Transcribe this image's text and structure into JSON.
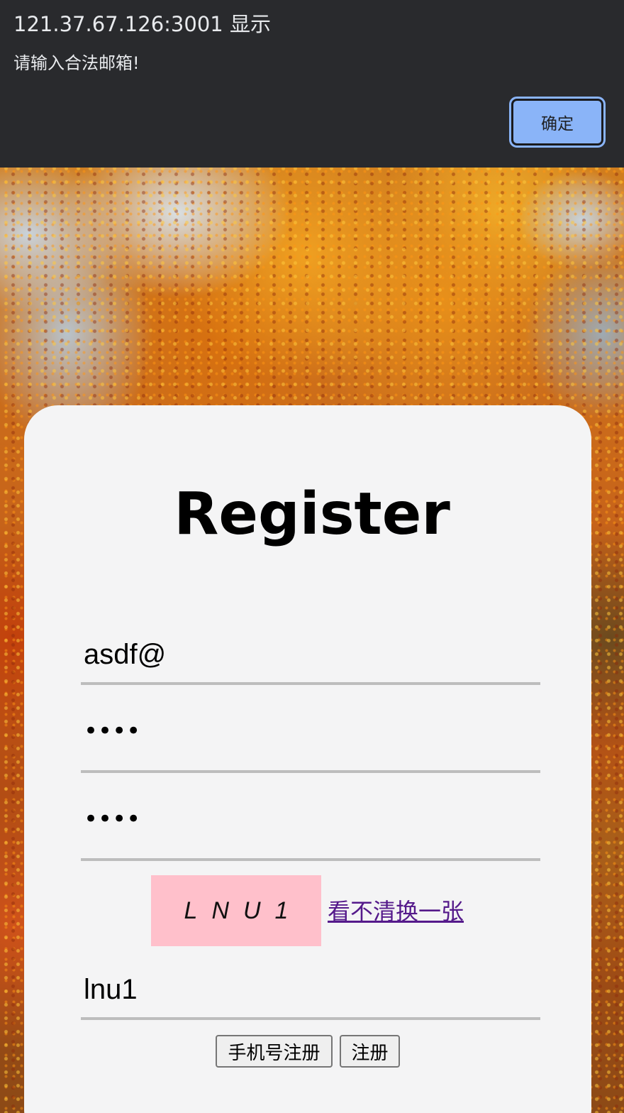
{
  "alert": {
    "title": "121.37.67.126:3001 显示",
    "message": "请输入合法邮箱!",
    "ok_label": "确定",
    "background": "#292a2d",
    "button_color": "#8ab4f8"
  },
  "register": {
    "title": "Register",
    "email_value": "asdf@",
    "password_masked": "••••",
    "confirm_password_masked": "••••",
    "captcha_text": "LNU1",
    "captcha_background": "#ffc0cb",
    "captcha_refresh_label": "看不清换一张",
    "captcha_input_value": "lnu1",
    "phone_register_label": "手机号注册",
    "register_label": "注册",
    "card_background": "#f4f4f5"
  }
}
